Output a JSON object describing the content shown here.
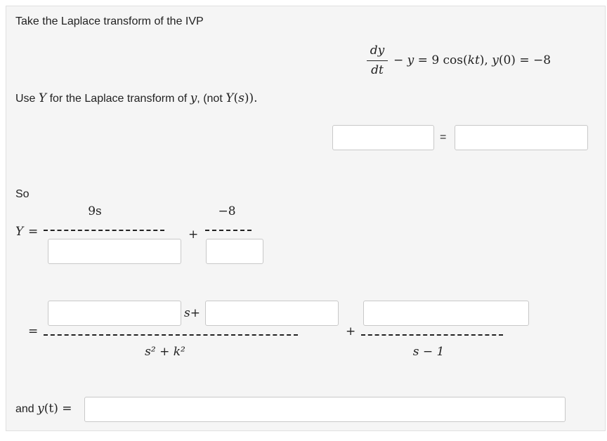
{
  "intro": "Take the Laplace transform of the IVP",
  "ivp": {
    "numerator": "dy",
    "denominator": "dt",
    "rest_a": "− ",
    "rest_y": "y",
    "rest_b": " = 9 cos(",
    "rest_kt": "kt",
    "rest_c": "), ",
    "rest_y0": "y",
    "rest_d": "(0) = −8"
  },
  "instruction": {
    "part1": "Use ",
    "Y1": "Y",
    "part2": " for the Laplace transform of ",
    "y": "y",
    "part3": ", (not ",
    "Y2": "Y",
    "paren_open": "(",
    "s": "s",
    "paren_close": "))."
  },
  "equals": "=",
  "so_label": "So",
  "Y_label": "Y",
  "first_expansion": {
    "num1": "9s",
    "plus": "+",
    "num2": "−8"
  },
  "second_expansion": {
    "s_plus": "s+",
    "den1": "s² + k²",
    "plus": "+",
    "den2": "s − 1"
  },
  "final": {
    "and": "and ",
    "y": "y",
    "t": "(t)",
    "eq": " ="
  },
  "inputs": {
    "lhs": "",
    "rhs": "",
    "den_a": "",
    "den_b": "",
    "num_a": "",
    "num_b": "",
    "num_c": "",
    "y_t": ""
  }
}
